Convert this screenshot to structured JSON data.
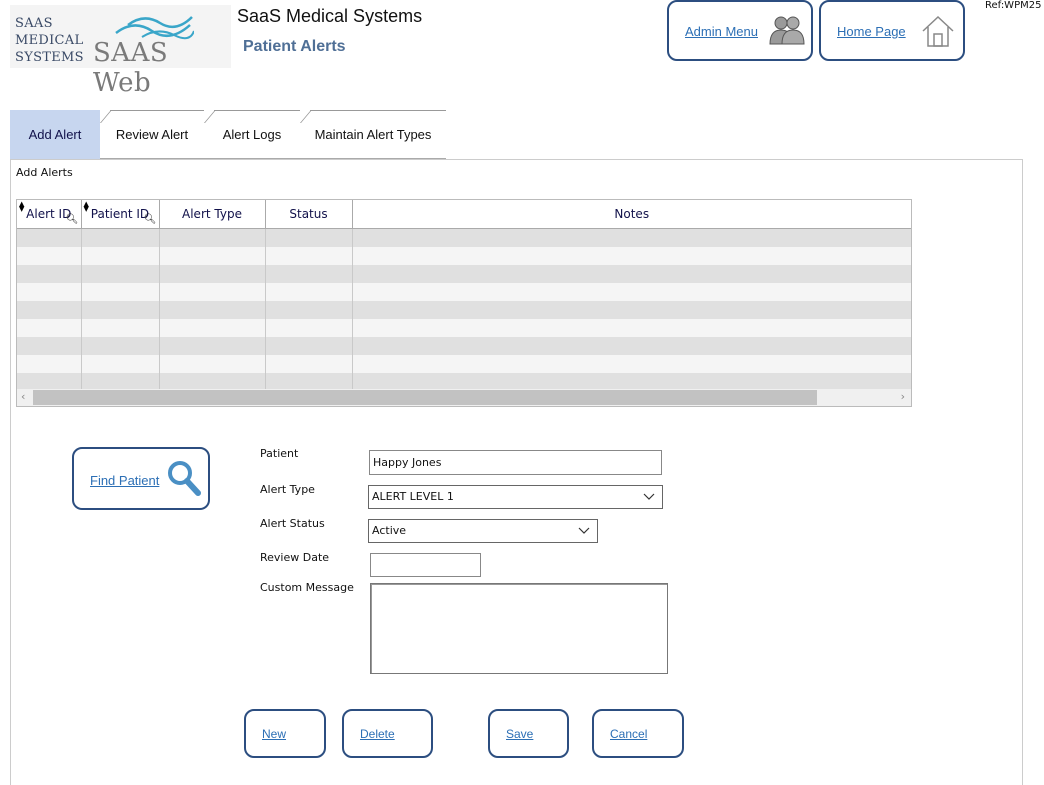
{
  "header": {
    "logo_company": [
      "SAAS",
      "MEDICAL",
      "SYSTEMS"
    ],
    "logo_product": "SAAS Web",
    "app_title": "SaaS Medical Systems",
    "page_title": "Patient Alerts",
    "ref": "Ref:WPM25",
    "admin_menu_label": "Admin Menu",
    "home_page_label": "Home Page"
  },
  "tabs": [
    {
      "label": "Add  Alert",
      "active": true
    },
    {
      "label": "Review Alert",
      "active": false
    },
    {
      "label": "Alert Logs",
      "active": false
    },
    {
      "label": "Maintain Alert Types",
      "active": false
    }
  ],
  "section_title": "Add Alerts",
  "grid": {
    "columns": [
      "Alert ID",
      "Patient ID",
      "Alert Type",
      "Status",
      "Notes"
    ]
  },
  "form": {
    "find_patient_label": "Find Patient",
    "patient_label": "Patient",
    "patient_value": "Happy Jones",
    "alert_type_label": "Alert Type",
    "alert_type_value": "ALERT LEVEL 1",
    "alert_status_label": "Alert Status",
    "alert_status_value": "Active",
    "review_date_label": "Review Date",
    "review_date_value": "",
    "custom_message_label": "Custom Message",
    "custom_message_value": ""
  },
  "actions": {
    "new_label": "New",
    "delete_label": "Delete",
    "save_label": "Save",
    "cancel_label": "Cancel"
  },
  "colors": {
    "brand_navy": "#2c4e80",
    "link_blue": "#2c6fb5",
    "active_tab": "#c7d6ef",
    "page_title": "#4f6f96"
  }
}
